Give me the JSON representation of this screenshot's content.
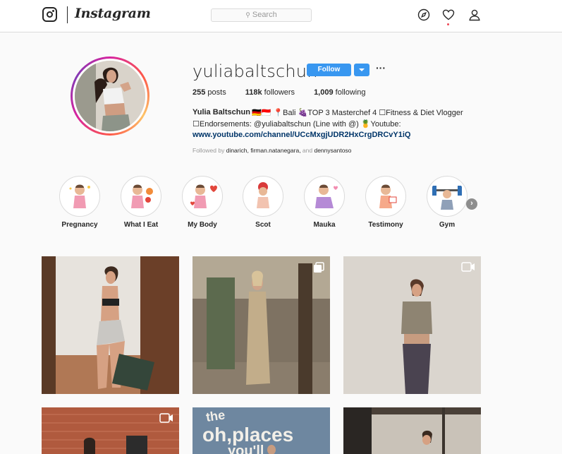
{
  "header": {
    "brand": "Instagram",
    "search_placeholder": "Search"
  },
  "profile": {
    "username": "yuliabaltschun",
    "follow_label": "Follow",
    "more_label": "···",
    "stats": [
      {
        "value": "255",
        "label": "posts"
      },
      {
        "value": "118k",
        "label": "followers"
      },
      {
        "value": "1,009",
        "label": "following"
      }
    ],
    "full_name": "Yulia Baltschun",
    "bio_line1": "🇩🇪🇮🇩 📍Bali 🍇TOP 3 Masterchef 4 ☐Fitness & Diet Vlogger",
    "bio_line2": "☐Endorsements: @yuliabaltschun (Line with @) 🍍Youtube:",
    "website": "www.youtube.com/channel/UCcMxgjUDR2HxCrgDRCvY1iQ",
    "followed_prefix": "Followed by ",
    "followed_names": "dinarich, firman.natanegara,",
    "followed_and": " and ",
    "followed_last": "dennysantoso"
  },
  "highlights": [
    {
      "label": "Pregnancy",
      "tint": "#f6dfe6"
    },
    {
      "label": "What I Eat",
      "tint": "#f3e3d3"
    },
    {
      "label": "My Body",
      "tint": "#fbe3e3"
    },
    {
      "label": "Scot",
      "tint": "#f7e0d6"
    },
    {
      "label": "Mauka",
      "tint": "#efe1f3"
    },
    {
      "label": "Testimony",
      "tint": "#fbe9dd"
    },
    {
      "label": "Gym",
      "tint": "#dfeaf5"
    }
  ],
  "posts": [
    {
      "kind": "photo",
      "badge": ""
    },
    {
      "kind": "photo",
      "badge": "multi-icon"
    },
    {
      "kind": "photo",
      "badge": "video-icon"
    },
    {
      "kind": "photo",
      "badge": "video-icon"
    },
    {
      "kind": "photo",
      "badge": "",
      "overlay_text": "the oh,places you'll"
    },
    {
      "kind": "photo",
      "badge": ""
    }
  ],
  "colors": {
    "accent": "#3897f0",
    "link": "#003569",
    "border": "#dbdbdb",
    "muted": "#999999"
  }
}
